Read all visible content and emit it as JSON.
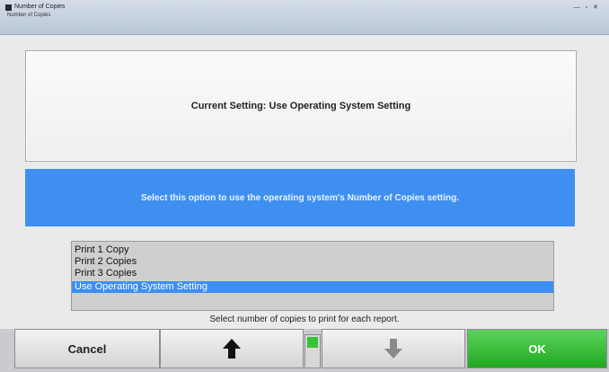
{
  "window": {
    "title": "Number of Copies",
    "subtitle": "Number of Copies",
    "controls": "— ▫ ✕"
  },
  "setting": {
    "label": "Current Setting:  Use Operating System Setting"
  },
  "info": {
    "text": "Select this option to use the operating system's Number of Copies setting."
  },
  "list": {
    "items": [
      {
        "label": "Print 1 Copy"
      },
      {
        "label": "Print 2 Copies"
      },
      {
        "label": "Print 3 Copies"
      },
      {
        "label": "Use Operating System Setting",
        "selected": true
      }
    ]
  },
  "hint": "Select number of copies to print for each report.",
  "buttons": {
    "cancel": "Cancel",
    "ok": "OK",
    "up_icon": "arrow-up-icon",
    "down_icon": "arrow-down-icon"
  },
  "colors": {
    "info_bar": "#3f8ff0",
    "selected_item": "#3b8ff2",
    "ok_button": "#21a821",
    "indicator": "#36c336"
  }
}
